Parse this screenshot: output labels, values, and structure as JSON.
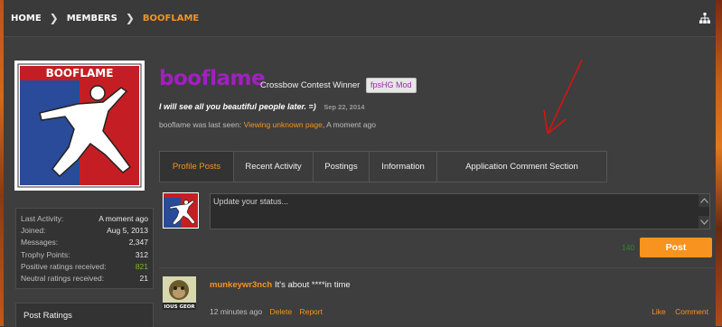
{
  "breadcrumb": {
    "items": [
      "HOME",
      "MEMBERS",
      "BOOFLAME"
    ],
    "separator": ">"
  },
  "profile": {
    "avatar_text": "BOOFLAME",
    "username": "booflame",
    "title": "Crossbow Contest Winner",
    "badge": "fpsHG Mod",
    "status_message": "I will see all you beautiful people later. =)",
    "status_date": "Sep 22, 2014",
    "last_seen_prefix": "booflame was last seen:",
    "last_seen_activity": "Viewing unknown page",
    "last_seen_time": ", A moment ago"
  },
  "stats": [
    {
      "label": "Last Activity:",
      "value": "A moment ago"
    },
    {
      "label": "Joined:",
      "value": "Aug 5, 2013"
    },
    {
      "label": "Messages:",
      "value": "2,347"
    },
    {
      "label": "Trophy Points:",
      "value": "312"
    },
    {
      "label": "Positive ratings received:",
      "value": "821"
    },
    {
      "label": "Neutral ratings received:",
      "value": "21"
    }
  ],
  "sidebar": {
    "post_ratings_title": "Post Ratings"
  },
  "tabs": [
    {
      "label": "Profile Posts"
    },
    {
      "label": "Recent Activity"
    },
    {
      "label": "Postings"
    },
    {
      "label": "Information"
    },
    {
      "label": "Application Comment Section"
    }
  ],
  "composer": {
    "placeholder": "Update your status...",
    "char_count": "140",
    "post_label": "Post"
  },
  "comment": {
    "author": "munkeywr3nch",
    "text": "It's about ****in time",
    "avatar_caption": "IOUS GEOR",
    "time": "12 minutes ago",
    "delete_label": "Delete",
    "report_label": "Report",
    "like_label": "Like",
    "comment_label": "Comment"
  },
  "colors": {
    "accent": "#f7931e",
    "username": "#a020c0",
    "positive": "#7ab829",
    "background": "#3e3e3e"
  }
}
